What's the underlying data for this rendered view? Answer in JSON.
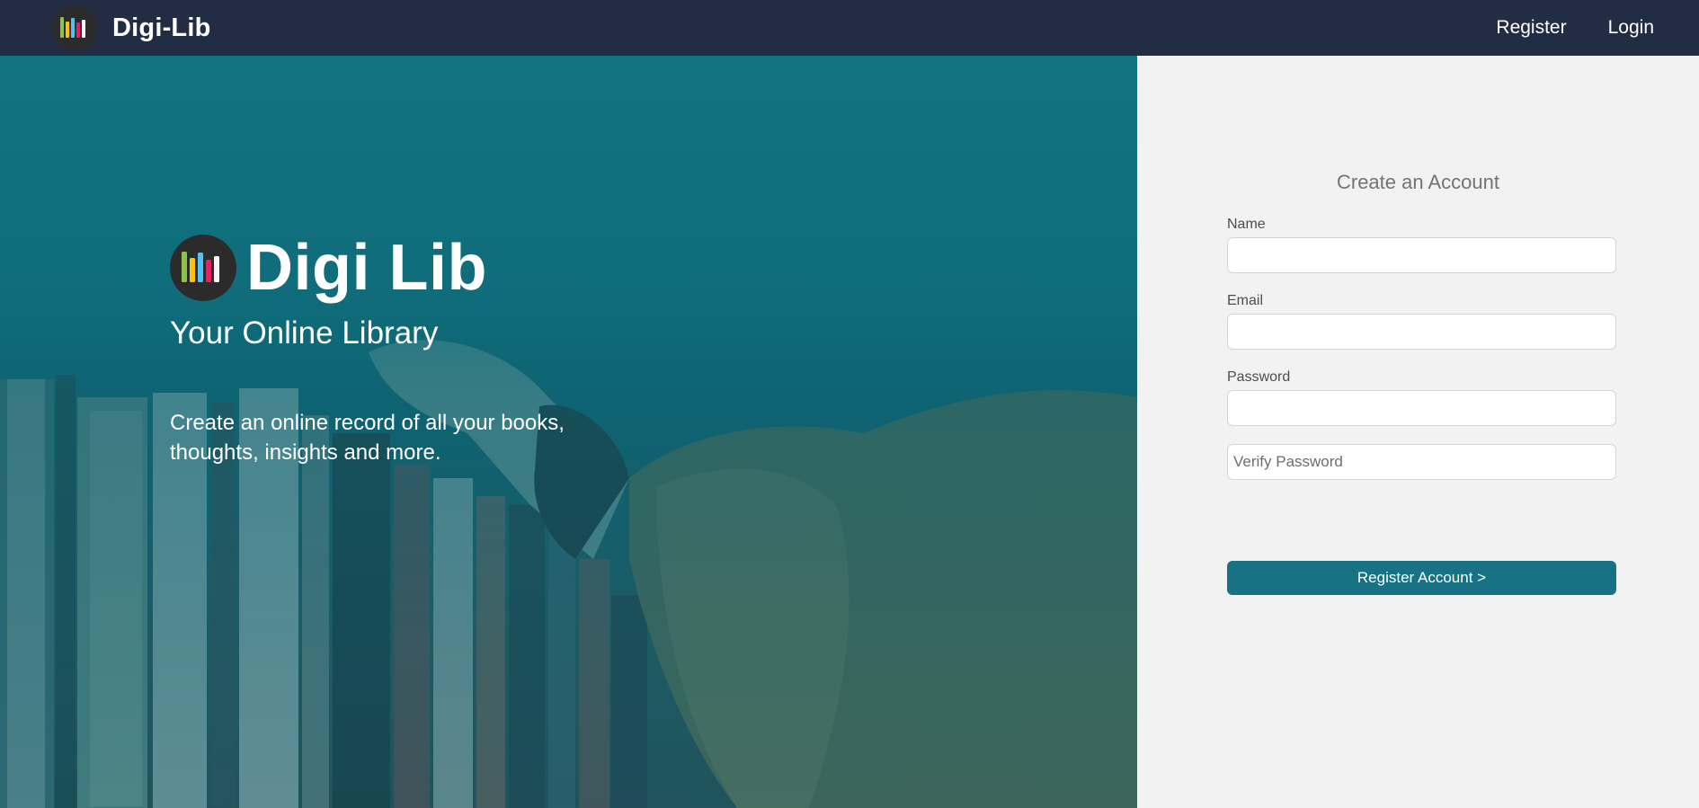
{
  "navbar": {
    "brand_name": "Digi-Lib",
    "links": {
      "register": "Register",
      "login": "Login"
    }
  },
  "hero": {
    "title": "Digi Lib",
    "subtitle": "Your Online Library",
    "description": "Create an online record of all your books, thoughts, insights and more."
  },
  "register_form": {
    "title": "Create an Account",
    "name_label": "Name",
    "name_value": "",
    "email_label": "Email",
    "email_value": "",
    "password_label": "Password",
    "password_value": "",
    "verify_password_placeholder": "Verify Password",
    "submit_label": "Register Account >"
  },
  "colors": {
    "navbar": "#222d44",
    "accent": "#177384",
    "panel_bg": "#f2f2f2",
    "logo_bg": "#2b2b2b",
    "logo_bars": [
      "#8bc34a",
      "#ffc107",
      "#4fc3f7",
      "#e91e63",
      "#f5f5f5"
    ]
  },
  "icons": {
    "logo": "bar-chart-logo-icon"
  }
}
